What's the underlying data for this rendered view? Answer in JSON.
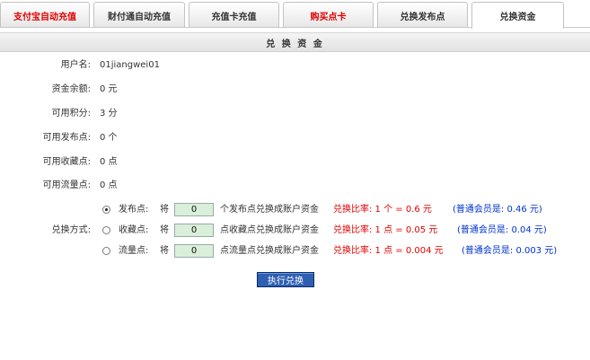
{
  "tabs": [
    {
      "label": "支付宝自动充值",
      "style": "red"
    },
    {
      "label": "财付通自动充值",
      "style": "normal"
    },
    {
      "label": "充值卡充值",
      "style": "normal"
    },
    {
      "label": "购买点卡",
      "style": "red"
    },
    {
      "label": "兑换发布点",
      "style": "normal"
    },
    {
      "label": "兑换资金",
      "style": "active"
    }
  ],
  "section_title": "兑 换 资 金",
  "info": [
    {
      "label": "用户名:",
      "value": "01jiangwei01"
    },
    {
      "label": "资金余额:",
      "value": "0 元"
    },
    {
      "label": "可用积分:",
      "value": "3 分"
    },
    {
      "label": "可用发布点:",
      "value": "0 个"
    },
    {
      "label": "可用收藏点:",
      "value": "0 点"
    },
    {
      "label": "可用流量点:",
      "value": "0 点"
    }
  ],
  "exchange": {
    "label": "兑换方式:",
    "jiang": "将",
    "options": [
      {
        "name": "发布点:",
        "value": "0",
        "desc": "个发布点兑换成账户资金",
        "rate": "兑换比率: 1 个 = 0.6 元",
        "member": "(普通会员是: 0.46 元)",
        "selected": true
      },
      {
        "name": "收藏点:",
        "value": "0",
        "desc": "点收藏点兑换成账户资金",
        "rate": "兑换比率: 1 点 = 0.05 元",
        "member": "(普通会员是: 0.04 元)",
        "selected": false
      },
      {
        "name": "流量点:",
        "value": "0",
        "desc": "点流量点兑换成账户资金",
        "rate": "兑换比率: 1 点 = 0.004 元",
        "member": "(普通会员是: 0.003 元)",
        "selected": false
      }
    ]
  },
  "submit_label": "执行兑换",
  "colors": {
    "red": "#e00000",
    "blue": "#0033cc",
    "button": "#2f5fb3"
  }
}
